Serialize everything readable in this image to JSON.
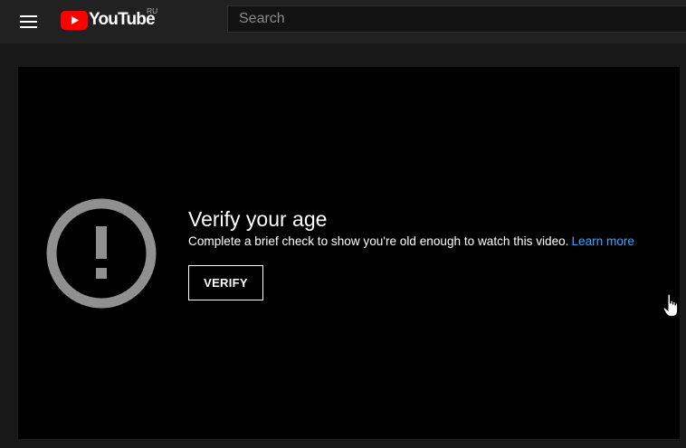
{
  "header": {
    "logo_text": "YouTube",
    "country_code": "RU",
    "search_placeholder": "Search"
  },
  "player": {
    "title": "Verify your age",
    "description": "Complete a brief check to show you're old enough to watch this video.",
    "learn_more_label": "Learn more",
    "verify_button_label": "VERIFY",
    "icon": "alert-circle-icon"
  },
  "colors": {
    "page_background": "#181818",
    "topbar_background": "#212121",
    "player_background": "#000000",
    "link": "#3ea6ff",
    "logo_red": "#ff0000",
    "icon_gray": "#909090"
  }
}
